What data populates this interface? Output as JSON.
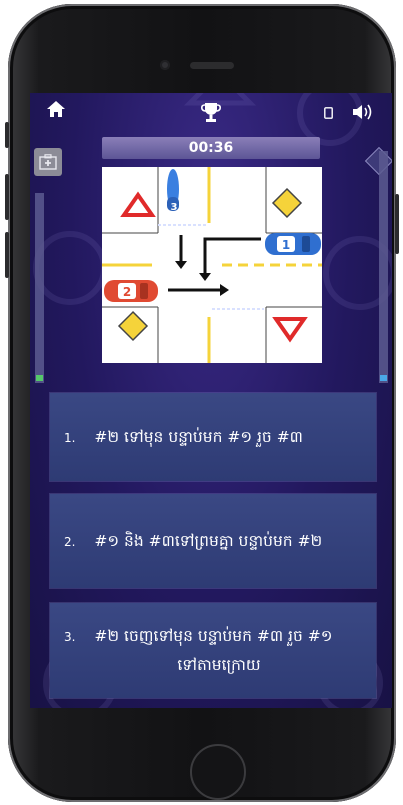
{
  "game": {
    "timer": "00:36"
  },
  "icons": {
    "home": "home-icon",
    "trophy": "trophy-icon",
    "phone": "phone-icon",
    "sound": "speaker-icon",
    "medkit": "medkit-icon",
    "hint": "diamond-hint-icon"
  },
  "scene": {
    "cars": [
      {
        "label": "1",
        "color": "#2f6fd0"
      },
      {
        "label": "2",
        "color": "#e04a32"
      },
      {
        "label": "3",
        "color": "#3a7fe0"
      }
    ],
    "signs": [
      "yield-sign",
      "priority-road-sign",
      "priority-road-sign",
      "yield-sign"
    ]
  },
  "answers": [
    {
      "num": "1.",
      "text": "#២ ទៅមុន បន្ទាប់មក #១ រួច #៣"
    },
    {
      "num": "2.",
      "text": "#១ និង #៣ទៅព្រមគ្នា បន្ទាប់មក #២"
    },
    {
      "num": "3.",
      "text": "#២ ចេញទៅមុន បន្ទាប់មក #៣ រួច #១",
      "text2": "ទៅតាមក្រោយ"
    }
  ],
  "colors": {
    "screen_bg": "#22185e",
    "answer_bg": "#2e3b74",
    "timer_bg": "#6b62a5",
    "road_yellow": "#f5d33a"
  }
}
